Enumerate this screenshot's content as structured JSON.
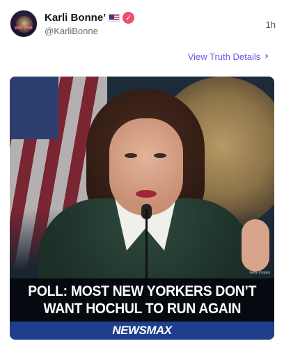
{
  "post": {
    "display_name": "Karli Bonne’",
    "flag_icon": "us-flag-icon",
    "verified_icon": "verified-badge-icon",
    "verified_glyph": "✓",
    "handle": "@KarliBonne",
    "timestamp": "1h",
    "avatar_text": "WE THE"
  },
  "details": {
    "label": "View Truth Details",
    "chevron": "›"
  },
  "media": {
    "credit": "Getty Images",
    "headline_lines": [
      "POLL: MOST NEW YORKERS DON’T",
      "WANT HOCHUL TO RUN AGAIN"
    ],
    "brand": "NEWSMAX",
    "colors": {
      "caption_bg": "#060a10",
      "brand_bg": "#1f3f8c",
      "verified": "#ee4d6e",
      "link": "#6a57e8"
    }
  }
}
